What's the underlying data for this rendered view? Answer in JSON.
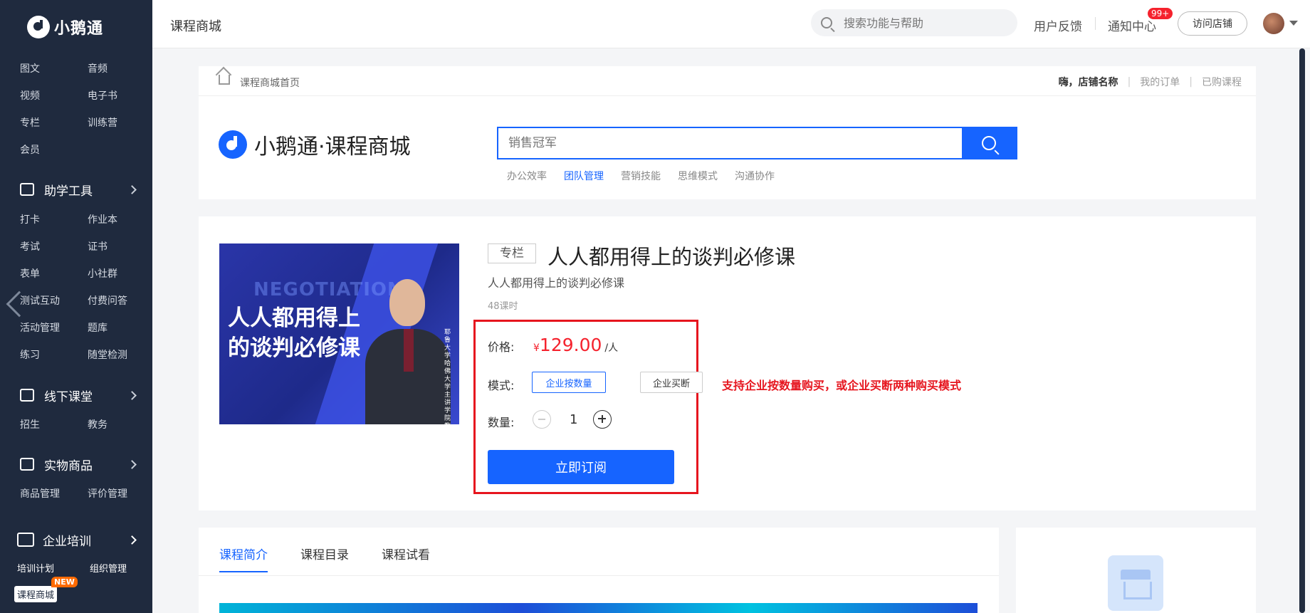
{
  "sidebar": {
    "logo_text": "小鹅通",
    "content_items": [
      "图文",
      "音频",
      "视频",
      "电子书",
      "专栏",
      "训练营",
      "会员"
    ],
    "groups": [
      {
        "label": "助学工具",
        "icon": "toolbox-icon",
        "items": [
          "打卡",
          "作业本",
          "考试",
          "证书",
          "表单",
          "小社群",
          "测试互动",
          "付费问答",
          "活动管理",
          "题库",
          "练习",
          "随堂检测"
        ]
      },
      {
        "label": "线下课堂",
        "icon": "classroom-icon",
        "items": [
          "招生",
          "教务"
        ]
      },
      {
        "label": "实物商品",
        "icon": "bag-icon",
        "items": [
          "商品管理",
          "评价管理"
        ]
      },
      {
        "label": "企业培训",
        "icon": "mail-icon",
        "items": [
          "培训计划",
          "组织管理"
        ]
      }
    ],
    "mall_label": "课程商城",
    "new_badge": "NEW"
  },
  "header": {
    "title": "课程商城",
    "search_placeholder": "搜索功能与帮助",
    "feedback": "用户反馈",
    "notifications": "通知中心",
    "notification_badge": "99+",
    "visit_store": "访问店铺"
  },
  "shop": {
    "breadcrumb": "课程商城首页",
    "greeting": "嗨，店铺名称",
    "my_orders": "我的订单",
    "purchased": "已购课程",
    "brand_name": "小鹅通",
    "brand_suffix": "·课程商城",
    "search_placeholder": "销售冠军",
    "hot_words": [
      "办公效率",
      "团队管理",
      "营销技能",
      "思维模式",
      "沟通协作"
    ],
    "active_hot_word": 1
  },
  "product": {
    "cover_word": "NEGOTIATION",
    "cover_title": "人人都用得上的谈判必修课",
    "cover_side_text": "耶鲁大学哈佛大学主讲学院教授",
    "tag": "专栏",
    "title": "人人都用得上的谈判必修课",
    "subtitle": "人人都用得上的谈判必修课",
    "lessons": "48课时",
    "price_label": "价格:",
    "currency": "¥",
    "price": "129.00",
    "price_unit": "/人",
    "mode_label": "模式:",
    "modes": [
      "企业按数量",
      "企业买断"
    ],
    "selected_mode": 0,
    "qty_label": "数量:",
    "quantity": "1",
    "subscribe": "立即订阅",
    "annotation": "支持企业按数量购买，或企业买断两种购买模式"
  },
  "tabs": {
    "items": [
      "课程简介",
      "课程目录",
      "课程试看"
    ],
    "active": 0
  },
  "colors": {
    "accent": "#1664ff",
    "sidebar": "#1f2a3e",
    "price": "#f5222d",
    "highlight": "#e6151e"
  }
}
